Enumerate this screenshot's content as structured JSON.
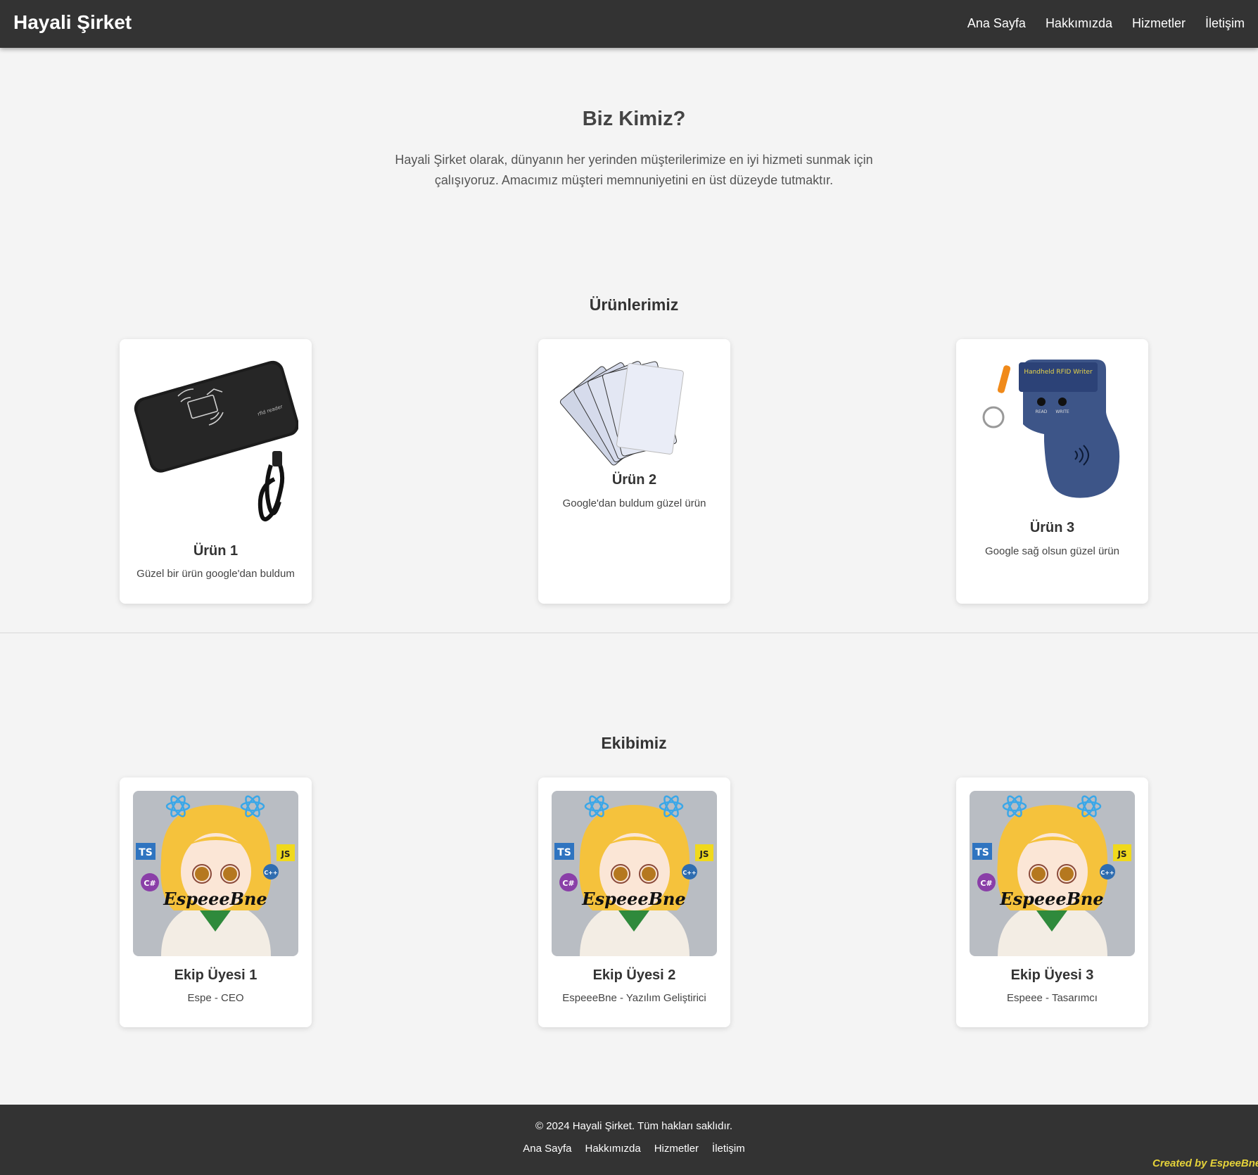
{
  "header": {
    "brand": "Hayali Şirket",
    "nav": [
      "Ana Sayfa",
      "Hakkımızda",
      "Hizmetler",
      "İletişim"
    ]
  },
  "about": {
    "title": "Biz Kimiz?",
    "text": "Hayali Şirket olarak, dünyanın her yerinden müşterilerimize en iyi hizmeti sunmak için çalışıyoruz. Amacımız müşteri memnuniyetini en üst düzeyde tutmaktır."
  },
  "products": {
    "title": "Ürünlerimiz",
    "items": [
      {
        "name": "Ürün 1",
        "desc": "Güzel bir ürün google'dan buldum",
        "icon": "rfid-reader-image"
      },
      {
        "name": "Ürün 2",
        "desc": "Google'dan buldum güzel ürün",
        "icon": "rfid-cards-image"
      },
      {
        "name": "Ürün 3",
        "desc": "Google sağ olsun güzel ürün",
        "icon": "rfid-writer-image",
        "device_label": "Handheld RFID Writer",
        "buttons": [
          "READ",
          "WRITE"
        ]
      }
    ]
  },
  "team": {
    "title": "Ekibimiz",
    "avatar_text": "EspeeeBne",
    "badges": [
      "TS",
      "JS",
      "C#",
      "C++"
    ],
    "members": [
      {
        "name": "Ekip Üyesi 1",
        "role": "Espe - CEO"
      },
      {
        "name": "Ekip Üyesi 2",
        "role": "EspeeeBne - Yazılım Geliştirici"
      },
      {
        "name": "Ekip Üyesi 3",
        "role": "Espeee - Tasarımcı"
      }
    ]
  },
  "footer": {
    "copyright": "© 2024 Hayali Şirket. Tüm hakları saklıdır.",
    "nav": [
      "Ana Sayfa",
      "Hakkımızda",
      "Hizmetler",
      "İletişim"
    ],
    "credit": "Created by EspeeBne"
  },
  "colors": {
    "header_bg": "#333333",
    "page_bg": "#f4f4f4",
    "credit": "#e5d23a"
  }
}
